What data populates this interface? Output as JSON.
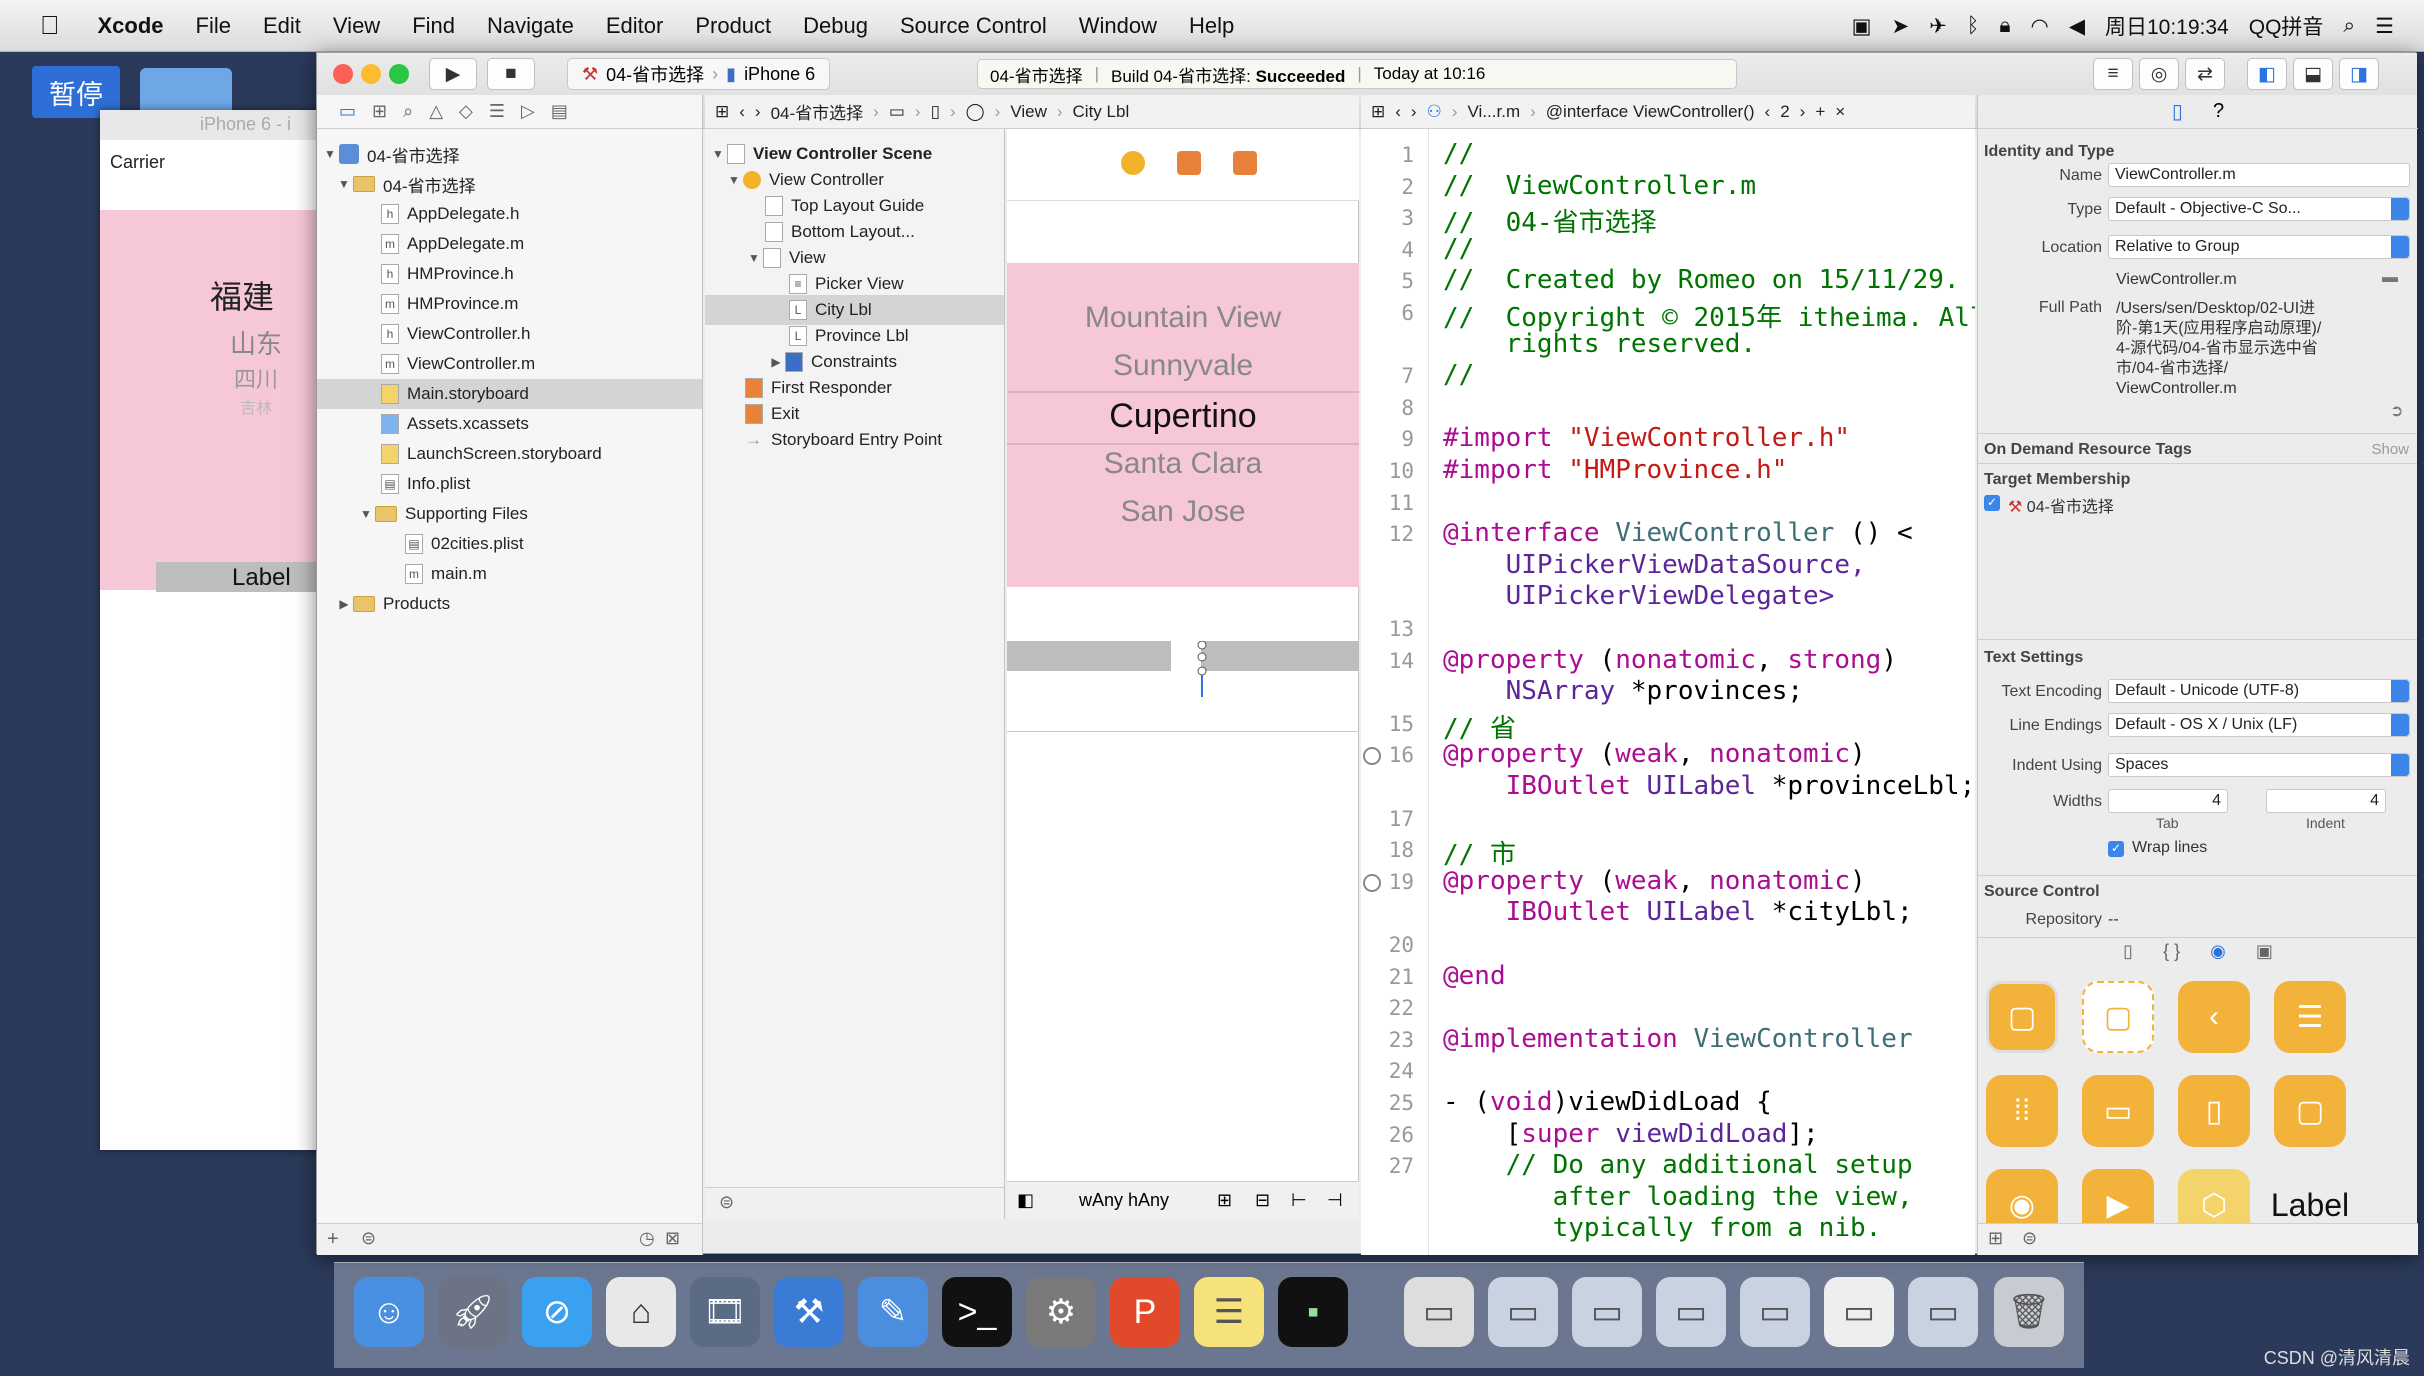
{
  "menubar": {
    "apple": "",
    "app": "Xcode",
    "items": [
      "File",
      "Edit",
      "View",
      "Find",
      "Navigate",
      "Editor",
      "Product",
      "Debug",
      "Source Control",
      "Window",
      "Help"
    ],
    "clock": "周日10:19:34",
    "input_method": "QQ拼音"
  },
  "desktop": {
    "pause_label": "暂停"
  },
  "simulator": {
    "title": "iPhone 6 - i",
    "carrier": "Carrier",
    "provinces": [
      "福建",
      "山东",
      "四川",
      "吉林"
    ],
    "label": "Label"
  },
  "toolbar": {
    "scheme": "04-省市选择",
    "device": "iPhone 6",
    "status_project": "04-省市选择",
    "status_build": "Build 04-省市选择:",
    "status_result": "Succeeded",
    "status_time": "Today at 10:16"
  },
  "navigator": {
    "project": "04-省市选择",
    "group": "04-省市选择",
    "files": [
      {
        "name": "AppDelegate.h",
        "type": "h"
      },
      {
        "name": "AppDelegate.m",
        "type": "m"
      },
      {
        "name": "HMProvince.h",
        "type": "h"
      },
      {
        "name": "HMProvince.m",
        "type": "m"
      },
      {
        "name": "ViewController.h",
        "type": "h"
      },
      {
        "name": "ViewController.m",
        "type": "m"
      },
      {
        "name": "Main.storyboard",
        "type": "sb"
      },
      {
        "name": "Assets.xcassets",
        "type": "as"
      },
      {
        "name": "LaunchScreen.storyboard",
        "type": "sb"
      },
      {
        "name": "Info.plist",
        "type": "pl"
      }
    ],
    "supporting": "Supporting Files",
    "supporting_files": [
      "02cities.plist",
      "main.m"
    ],
    "products": "Products"
  },
  "outline": {
    "scene": "View Controller Scene",
    "vc": "View Controller",
    "items": [
      "Top Layout Guide",
      "Bottom Layout...",
      "View",
      "Picker View",
      "City Lbl",
      "Province Lbl",
      "Constraints",
      "First Responder",
      "Exit",
      "Storyboard Entry Point"
    ]
  },
  "jumpbar1": {
    "project": "04-省市选择",
    "view": "View",
    "lbl": "City Lbl"
  },
  "canvas": {
    "picker": [
      "Mountain View",
      "Sunnyvale",
      "Cupertino",
      "Santa Clara",
      "San Jose"
    ],
    "size_w": "wAny",
    "size_h": "hAny"
  },
  "jumpbar2": {
    "file": "Vi...r.m",
    "symbol": "@interface ViewController()",
    "count": "2"
  },
  "code": [
    {
      "n": "1",
      "t": "//",
      "c": "cm"
    },
    {
      "n": "2",
      "t": "//  ViewController.m",
      "c": "cm"
    },
    {
      "n": "3",
      "t": "//  04-省市选择",
      "c": "cm"
    },
    {
      "n": "4",
      "t": "//",
      "c": "cm"
    },
    {
      "n": "5",
      "t": "//  Created by Romeo on 15/11/29.",
      "c": "cm"
    },
    {
      "n": "6",
      "t": "//  Copyright © 2015年 itheima. All",
      "c": "cm"
    },
    {
      "n": "",
      "t": "    rights reserved.",
      "c": "cm"
    },
    {
      "n": "7",
      "t": "//",
      "c": "cm"
    },
    {
      "n": "8",
      "t": "",
      "c": ""
    },
    {
      "n": "9",
      "t": "#import \"ViewController.h\"",
      "c": "im"
    },
    {
      "n": "10",
      "t": "#import \"HMProvince.h\"",
      "c": "im"
    },
    {
      "n": "11",
      "t": "",
      "c": ""
    },
    {
      "n": "12",
      "t": "@interface ViewController () <",
      "c": "if"
    },
    {
      "n": "",
      "t": "    UIPickerViewDataSource,",
      "c": "pr"
    },
    {
      "n": "",
      "t": "    UIPickerViewDelegate>",
      "c": "pr"
    },
    {
      "n": "13",
      "t": "",
      "c": ""
    },
    {
      "n": "14",
      "t": "@property (nonatomic, strong)",
      "c": "kw"
    },
    {
      "n": "",
      "t": "    NSArray *provinces;",
      "c": "pr2"
    },
    {
      "n": "15",
      "t": "// 省",
      "c": "cm"
    },
    {
      "n": "16",
      "t": "@property (weak, nonatomic)",
      "c": "kw"
    },
    {
      "n": "",
      "t": "    IBOutlet UILabel *provinceLbl;",
      "c": "ib"
    },
    {
      "n": "17",
      "t": "",
      "c": ""
    },
    {
      "n": "18",
      "t": "// 市",
      "c": "cm"
    },
    {
      "n": "19",
      "t": "@property (weak, nonatomic)",
      "c": "kw"
    },
    {
      "n": "",
      "t": "    IBOutlet UILabel *cityLbl;",
      "c": "ib"
    },
    {
      "n": "20",
      "t": "",
      "c": ""
    },
    {
      "n": "21",
      "t": "@end",
      "c": "kw"
    },
    {
      "n": "22",
      "t": "",
      "c": ""
    },
    {
      "n": "23",
      "t": "@implementation ViewController",
      "c": "if"
    },
    {
      "n": "24",
      "t": "",
      "c": ""
    },
    {
      "n": "25",
      "t": "- (void)viewDidLoad {",
      "c": "vd"
    },
    {
      "n": "26",
      "t": "    [super viewDidLoad];",
      "c": "sp"
    },
    {
      "n": "27",
      "t": "    // Do any additional setup",
      "c": "cm"
    },
    {
      "n": "",
      "t": "       after loading the view,",
      "c": "cm"
    },
    {
      "n": "",
      "t": "       typically from a nib.",
      "c": "cm"
    }
  ],
  "inspector": {
    "identity_title": "Identity and Type",
    "name_label": "Name",
    "name_value": "ViewController.m",
    "type_label": "Type",
    "type_value": "Default - Objective-C So...",
    "location_label": "Location",
    "location_value": "Relative to Group",
    "location_file": "ViewController.m",
    "fullpath_label": "Full Path",
    "fullpath_lines": [
      "/Users/sen/Desktop/02-UI进",
      "阶-第1天(应用程序启动原理)/",
      "4-源代码/04-省市显示选中省",
      "市/04-省市选择/",
      "ViewController.m"
    ],
    "odr_title": "On Demand Resource Tags",
    "odr_show": "Show",
    "target_title": "Target Membership",
    "target_name": "04-省市选择",
    "text_title": "Text Settings",
    "encoding_label": "Text Encoding",
    "encoding_value": "Default - Unicode (UTF-8)",
    "endings_label": "Line Endings",
    "endings_value": "Default - OS X / Unix (LF)",
    "indent_label": "Indent Using",
    "indent_value": "Spaces",
    "widths_label": "Widths",
    "tab_value": "4",
    "indent_width_value": "4",
    "tab_label": "Tab",
    "indent_sub_label": "Indent",
    "wrap_label": "Wrap lines",
    "sc_title": "Source Control",
    "repo_label": "Repository",
    "repo_value": "--",
    "lib_label": "Label"
  },
  "watermark": "CSDN @清风清晨"
}
